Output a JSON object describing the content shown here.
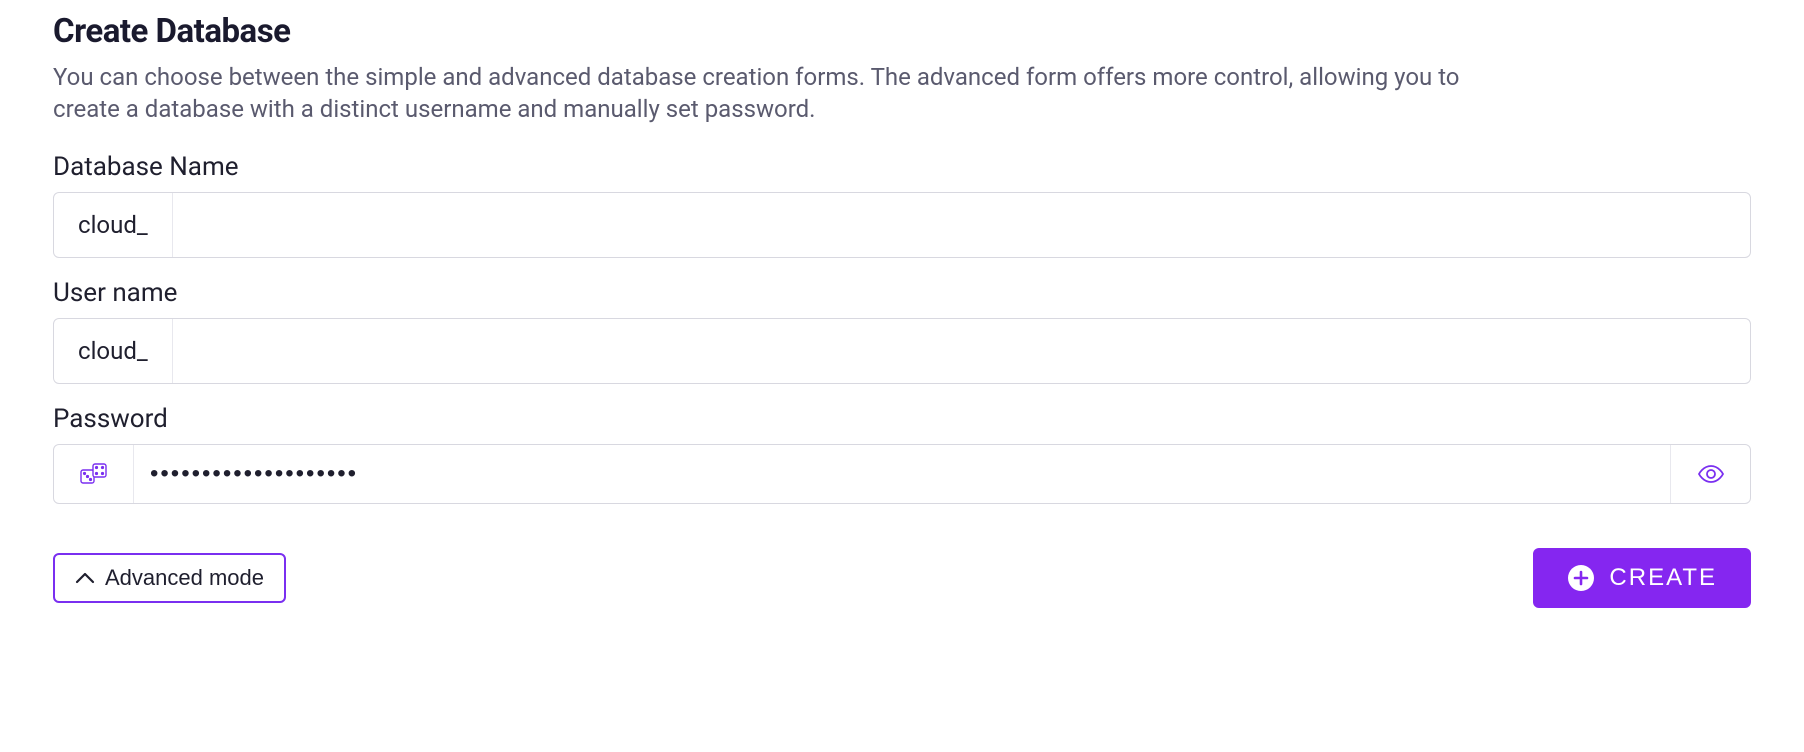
{
  "header": {
    "title": "Create Database",
    "description": "You can choose between the simple and advanced database creation forms. The advanced form offers more control, allowing you to create a database with a distinct username and manually set password."
  },
  "fields": {
    "databaseName": {
      "label": "Database Name",
      "prefix": "cloud_",
      "value": ""
    },
    "userName": {
      "label": "User name",
      "prefix": "cloud_",
      "value": ""
    },
    "password": {
      "label": "Password",
      "value": "••••••••••••••••••••"
    }
  },
  "actions": {
    "advancedMode": "Advanced mode",
    "create": "CREATE"
  }
}
